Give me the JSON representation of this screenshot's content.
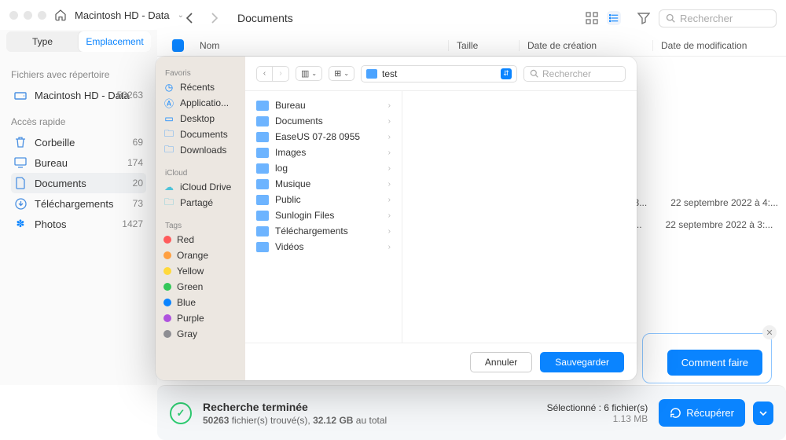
{
  "breadcrumb": {
    "volume": "Macintosh HD - Data"
  },
  "toolbar": {
    "title": "Documents",
    "search_ph": "Rechercher"
  },
  "tabs": {
    "type": "Type",
    "location": "Emplacement"
  },
  "left": {
    "repo_heading": "Fichiers avec répertoire",
    "drive": {
      "name": "Macintosh HD - Data",
      "count": "50263"
    },
    "quick_heading": "Accès rapide",
    "items": [
      {
        "name": "Corbeille",
        "count": "69"
      },
      {
        "name": "Bureau",
        "count": "174"
      },
      {
        "name": "Documents",
        "count": "20"
      },
      {
        "name": "Téléchargements",
        "count": "73"
      },
      {
        "name": "Photos",
        "count": "1427"
      }
    ]
  },
  "columns": {
    "name": "Nom",
    "size": "Taille",
    "created": "Date de création",
    "modified": "Date de modification"
  },
  "visible_rows": [
    {
      "created_tail": "13...",
      "modified": "22 septembre 2022 à 4:..."
    },
    {
      "created_tail": "à...",
      "modified": "22 septembre 2022 à 3:..."
    }
  ],
  "howto": {
    "label": "Comment faire"
  },
  "status": {
    "title": "Recherche terminée",
    "count": "50263",
    "found_label": "fichier(s) trouvé(s),",
    "size": "32.12 GB",
    "total_label": "au total",
    "sel_label": "Sélectionné : 6 fichier(s)",
    "sel_size": "1.13 MB",
    "recover": "Récupérer"
  },
  "modal": {
    "side": {
      "fav_h": "Favoris",
      "favs": [
        "Récents",
        "Applicatio...",
        "Desktop",
        "Documents",
        "Downloads"
      ],
      "icloud_h": "iCloud",
      "icloud": [
        "iCloud Drive",
        "Partagé"
      ],
      "tags_h": "Tags",
      "tags": [
        {
          "name": "Red",
          "color": "#ff5b5b"
        },
        {
          "name": "Orange",
          "color": "#ff9f40"
        },
        {
          "name": "Yellow",
          "color": "#ffd93b"
        },
        {
          "name": "Green",
          "color": "#34c759"
        },
        {
          "name": "Blue",
          "color": "#0a84ff"
        },
        {
          "name": "Purple",
          "color": "#af52de"
        },
        {
          "name": "Gray",
          "color": "#8e8e93"
        }
      ]
    },
    "location": "test",
    "search_ph": "Rechercher",
    "folders": [
      "Bureau",
      "Documents",
      "EaseUS 07-28 0955",
      "Images",
      "log",
      "Musique",
      "Public",
      "Sunlogin Files",
      "Téléchargements",
      "Vidéos"
    ],
    "cancel": "Annuler",
    "save": "Sauvegarder"
  }
}
